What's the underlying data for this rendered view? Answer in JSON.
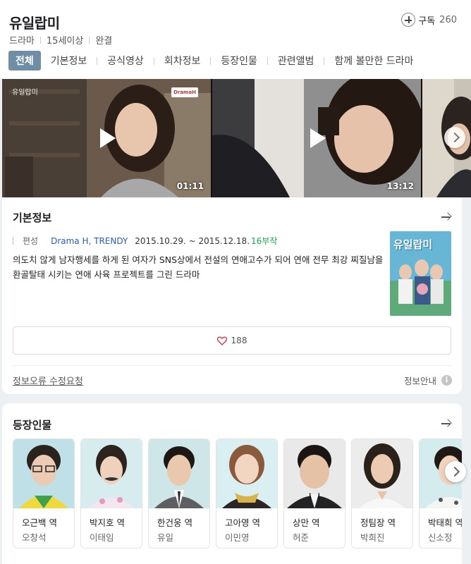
{
  "header": {
    "title": "유일랍미",
    "genre": "드라마",
    "rating": "15세이상",
    "status": "완결",
    "subscribe_label": "구독",
    "subscribe_count": "260"
  },
  "tabs": [
    "전체",
    "기본정보",
    "공식영상",
    "회차정보",
    "등장인물",
    "관련앨범",
    "함께 볼만한 드라마"
  ],
  "videos": [
    {
      "duration": "01:11",
      "watermark": "유일랍미",
      "logo": "DramaH"
    },
    {
      "duration": "13:12"
    }
  ],
  "basic_info": {
    "title": "기본정보",
    "label": "편성",
    "channels": "Drama H, TRENDY",
    "dates": "2015.10.29. ~ 2015.12.18.",
    "episodes": "16부작",
    "description": "의도치 않게 남자행세를 하게 된 여자가 SNS상에서 전설의 연애고수가 되어 연애 전무 최강 찌질남을 환골탈태 시키는 연애 사육 프로젝트를 그린 드라마",
    "poster_title": "유일랍미",
    "likes": "188",
    "report_link": "정보오류 수정요청",
    "info_guide": "정보안내"
  },
  "cast": {
    "title": "등장인물",
    "people": [
      {
        "role": "오근백 역",
        "actor": "오창석"
      },
      {
        "role": "박지호 역",
        "actor": "이태임"
      },
      {
        "role": "한건웅 역",
        "actor": "유일"
      },
      {
        "role": "고아영 역",
        "actor": "이민영"
      },
      {
        "role": "상만 역",
        "actor": "허준"
      },
      {
        "role": "정팀장 역",
        "actor": "박희진"
      },
      {
        "role": "박태희 역",
        "actor": "신소정"
      }
    ]
  }
}
